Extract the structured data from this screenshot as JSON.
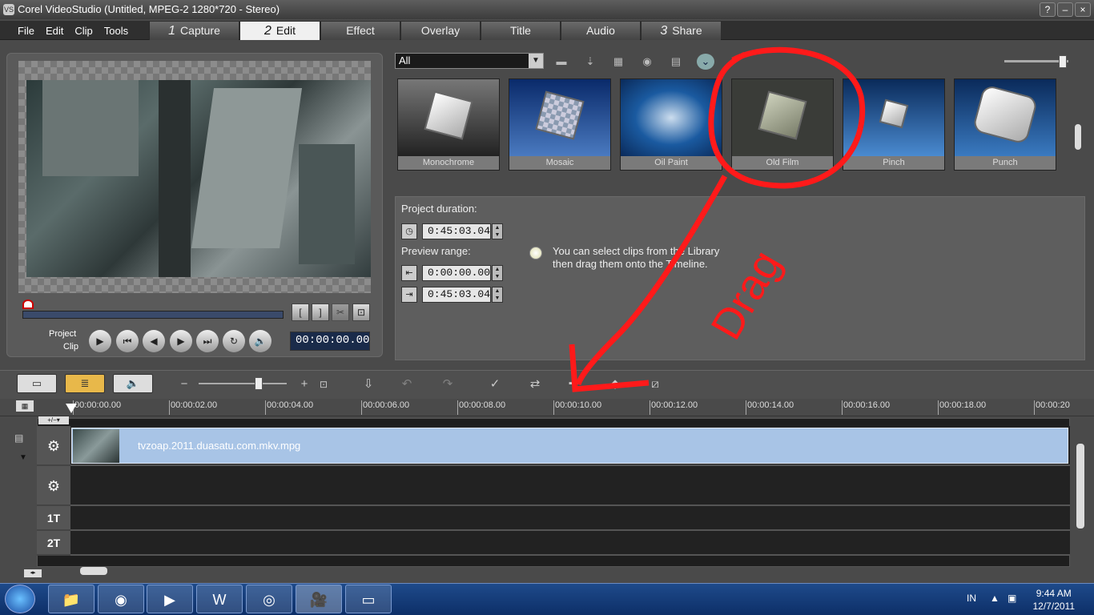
{
  "window": {
    "title": "Corel VideoStudio (Untitled, MPEG-2 1280*720 - Stereo)",
    "help": "?",
    "minimize": "–",
    "close": "×"
  },
  "menu": [
    "File",
    "Edit",
    "Clip",
    "Tools"
  ],
  "tabs": [
    {
      "num": "1",
      "label": "Capture"
    },
    {
      "num": "2",
      "label": "Edit"
    },
    {
      "num": "",
      "label": "Effect"
    },
    {
      "num": "",
      "label": "Overlay"
    },
    {
      "num": "",
      "label": "Title"
    },
    {
      "num": "",
      "label": "Audio"
    },
    {
      "num": "3",
      "label": "Share"
    }
  ],
  "player": {
    "mode_project": "Project",
    "mode_clip": "Clip",
    "timecode": "00:00:00.00"
  },
  "library": {
    "filter": "All",
    "effects": [
      "Monochrome",
      "Mosaic",
      "Oil Paint",
      "Old Film",
      "Pinch",
      "Punch"
    ],
    "project_duration_label": "Project duration:",
    "project_duration": "0:45:03.04",
    "preview_range_label": "Preview range:",
    "range_start": "0:00:00.00",
    "range_end": "0:45:03.04",
    "tip": "You can select clips from the Library then drag them onto the Timeline."
  },
  "timeline": {
    "ticks": [
      "00:00:00.00",
      "00:00:02.00",
      "00:00:04.00",
      "00:00:06.00",
      "00:00:08.00",
      "00:00:10.00",
      "00:00:12.00",
      "00:00:14.00",
      "00:00:16.00",
      "00:00:18.00",
      "00:00:20"
    ],
    "clip_name": "tvzoap.2011.duasatu.com.mkv.mpg",
    "title_tracks": [
      "1T",
      "2T"
    ]
  },
  "annotation": {
    "text": "Drag",
    "color": "#ff1a1a"
  },
  "taskbar": {
    "lang": "IN",
    "time": "9:44 AM",
    "date": "12/7/2011"
  }
}
